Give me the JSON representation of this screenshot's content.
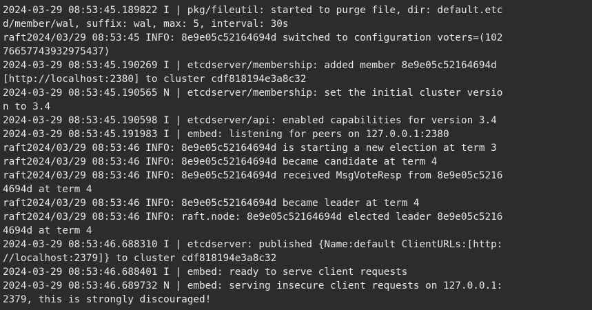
{
  "terminal": {
    "lines": [
      "2024-03-29 08:53:45.189822 I | pkg/fileutil: started to purge file, dir: default.etc",
      "d/member/wal, suffix: wal, max: 5, interval: 30s",
      "raft2024/03/29 08:53:45 INFO: 8e9e05c52164694d switched to configuration voters=(102",
      "76657743932975437)",
      "2024-03-29 08:53:45.190269 I | etcdserver/membership: added member 8e9e05c52164694d",
      "[http://localhost:2380] to cluster cdf818194e3a8c32",
      "2024-03-29 08:53:45.190565 N | etcdserver/membership: set the initial cluster versio",
      "n to 3.4",
      "2024-03-29 08:53:45.190598 I | etcdserver/api: enabled capabilities for version 3.4",
      "2024-03-29 08:53:45.191983 I | embed: listening for peers on 127.0.0.1:2380",
      "raft2024/03/29 08:53:46 INFO: 8e9e05c52164694d is starting a new election at term 3",
      "raft2024/03/29 08:53:46 INFO: 8e9e05c52164694d became candidate at term 4",
      "raft2024/03/29 08:53:46 INFO: 8e9e05c52164694d received MsgVoteResp from 8e9e05c5216",
      "4694d at term 4",
      "raft2024/03/29 08:53:46 INFO: 8e9e05c52164694d became leader at term 4",
      "raft2024/03/29 08:53:46 INFO: raft.node: 8e9e05c52164694d elected leader 8e9e05c5216",
      "4694d at term 4",
      "2024-03-29 08:53:46.688310 I | etcdserver: published {Name:default ClientURLs:[http:",
      "//localhost:2379]} to cluster cdf818194e3a8c32",
      "2024-03-29 08:53:46.688401 I | embed: ready to serve client requests",
      "2024-03-29 08:53:46.689732 N | embed: serving insecure client requests on 127.0.0.1:",
      "2379, this is strongly discouraged!"
    ]
  },
  "colors": {
    "background": "#2c2c2c",
    "foreground": "#e6e6e6"
  }
}
